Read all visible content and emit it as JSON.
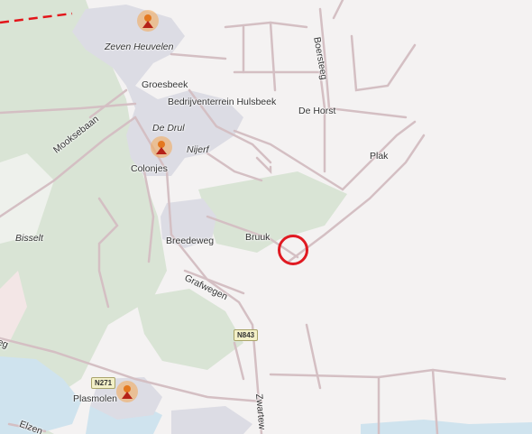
{
  "map": {
    "places": {
      "zeven_heuvelen": "Zeven Heuvelen",
      "groesbeek": "Groesbeek",
      "bedrijventerrein": "Bedrijventerrein Hulsbeek",
      "de_horst": "De Horst",
      "de_drul": "De Drul",
      "nijerf": "Nijerf",
      "colonjes": "Colonjes",
      "plak": "Plak",
      "bisselt": "Bisselt",
      "breedeweg": "Breedeweg",
      "bruuk": "Bruuk",
      "plasmolen": "Plasmolen"
    },
    "roads": {
      "mooksebaan": "Mooksebaan",
      "boersteeg": "Boersteeg",
      "grafwegen": "Grafwegen",
      "zwartewaterweg": "Zwartew",
      "elzen": "Elzen",
      "west_edge": "eg"
    },
    "shields": {
      "n843": "N843",
      "n271": "N271"
    },
    "colors": {
      "background": "#f4f2f2",
      "forest": "#d9e4d5",
      "water": "#cfe3ee",
      "urban": "#dcdce4",
      "road": "#d4bfc3",
      "marker": "#e01a22",
      "boundary": "#e3151a"
    },
    "icons": [
      "poi-icon",
      "location-marker"
    ]
  }
}
